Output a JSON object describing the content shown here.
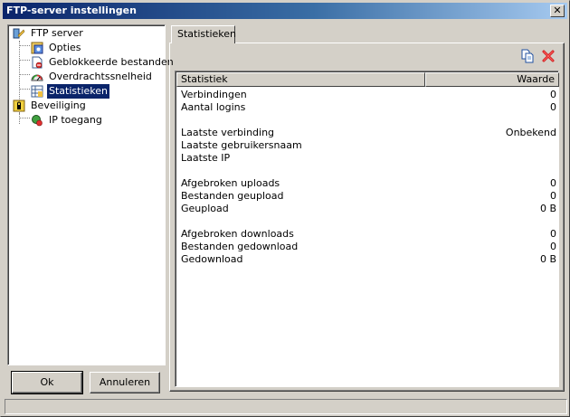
{
  "window": {
    "title": "FTP-server instellingen",
    "close_glyph": "✕"
  },
  "tree": {
    "items": [
      {
        "label": "FTP server",
        "icon": "ftp-server-icon"
      },
      {
        "label": "Opties",
        "icon": "options-icon"
      },
      {
        "label": "Geblokkeerde bestanden",
        "icon": "blocked-files-icon"
      },
      {
        "label": "Overdrachtssnelheid",
        "icon": "speed-gauge-icon"
      },
      {
        "label": "Statistieken",
        "icon": "statistics-icon",
        "selected": true
      },
      {
        "label": "Beveiliging",
        "icon": "lock-icon"
      },
      {
        "label": "IP toegang",
        "icon": "ip-access-icon"
      }
    ]
  },
  "buttons": {
    "ok": "Ok",
    "cancel": "Annuleren"
  },
  "tab": {
    "label": "Statistieken"
  },
  "toolbar": {
    "copy_icon": "copy-icon",
    "delete_icon": "delete-icon"
  },
  "table": {
    "headers": [
      "Statistiek",
      "Waarde"
    ],
    "rows": [
      {
        "name": "Verbindingen",
        "value": "0"
      },
      {
        "name": "Aantal logins",
        "value": "0"
      },
      {
        "name": "",
        "value": ""
      },
      {
        "name": "Laatste verbinding",
        "value": "Onbekend"
      },
      {
        "name": "Laatste gebruikersnaam",
        "value": ""
      },
      {
        "name": "Laatste IP",
        "value": ""
      },
      {
        "name": "",
        "value": ""
      },
      {
        "name": "Afgebroken uploads",
        "value": "0"
      },
      {
        "name": "Bestanden geupload",
        "value": "0"
      },
      {
        "name": "Geupload",
        "value": "0 B"
      },
      {
        "name": "",
        "value": ""
      },
      {
        "name": "Afgebroken downloads",
        "value": "0"
      },
      {
        "name": "Bestanden gedownload",
        "value": "0"
      },
      {
        "name": "Gedownload",
        "value": "0 B"
      }
    ]
  },
  "colors": {
    "title_start": "#0a246a",
    "title_end": "#a6caf0",
    "selection": "#0a246a",
    "face": "#d4d0c8"
  }
}
